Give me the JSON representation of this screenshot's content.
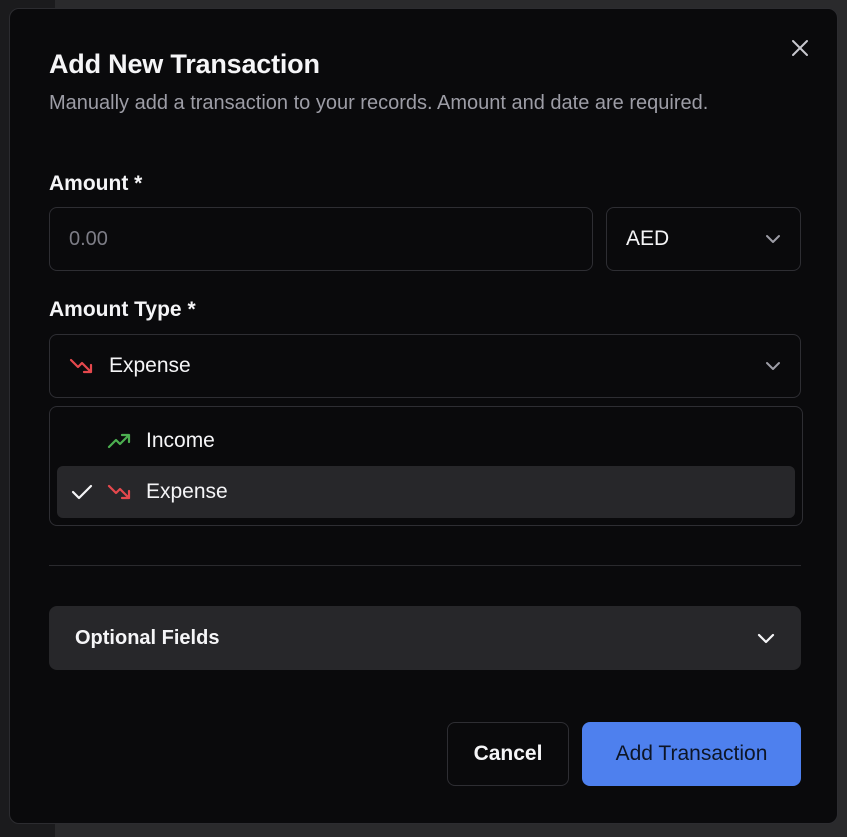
{
  "dialog": {
    "title": "Add New Transaction",
    "subtitle": "Manually add a transaction to your records. Amount and date are required.",
    "close_icon": "close-icon"
  },
  "amount": {
    "label": "Amount *",
    "placeholder": "0.00",
    "value": "",
    "currency": "AED"
  },
  "amount_type": {
    "label": "Amount Type *",
    "selected": "Expense",
    "options": [
      {
        "label": "Income",
        "icon": "trending-up-icon",
        "color": "#4caf50",
        "selected": false
      },
      {
        "label": "Expense",
        "icon": "trending-down-icon",
        "color": "#e5484d",
        "selected": true
      }
    ]
  },
  "optional_fields": {
    "label": "Optional Fields"
  },
  "actions": {
    "cancel": "Cancel",
    "submit": "Add Transaction"
  },
  "colors": {
    "accent": "#4e80ee",
    "income": "#4caf50",
    "expense": "#e5484d",
    "background": "#0a0a0c"
  }
}
